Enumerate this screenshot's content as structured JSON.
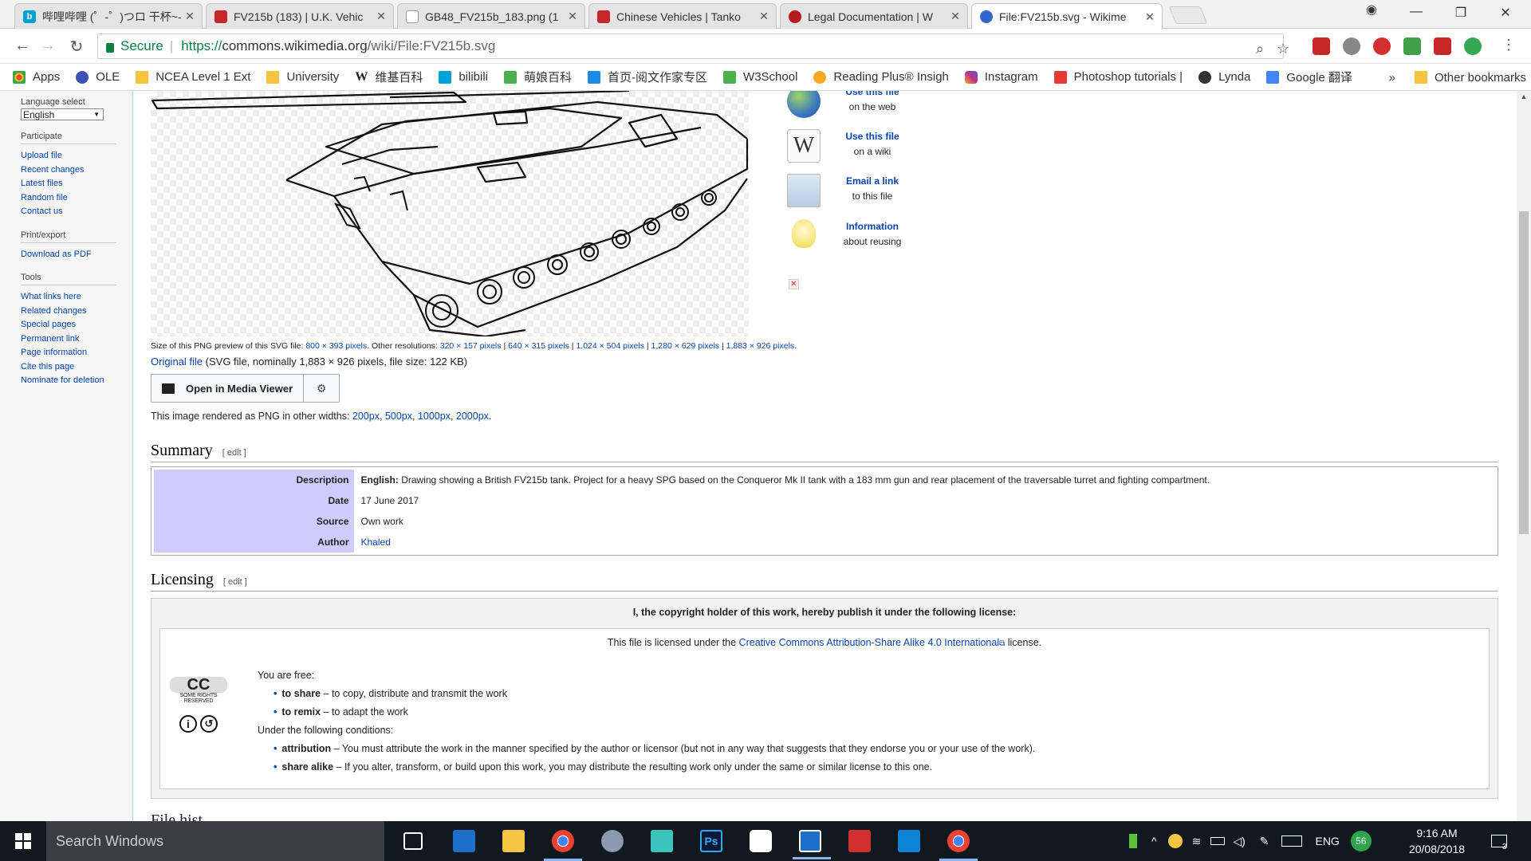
{
  "tabs": [
    {
      "title": "哔哩哔哩 (゜-゜)つロ 干杯~-",
      "color": "#00a1d6"
    },
    {
      "title": "FV215b (183) | U.K. Vehic",
      "color": "#c62828"
    },
    {
      "title": "GB48_FV215b_183.png (1",
      "color": "#777777"
    },
    {
      "title": "Chinese Vehicles | Tanko",
      "color": "#c62828"
    },
    {
      "title": "Legal Documentation | W",
      "color": "#b71c1c"
    },
    {
      "title": "File:FV215b.svg - Wikime",
      "color": "#3366cc"
    }
  ],
  "address": {
    "secure_label": "Secure",
    "scheme": "https://",
    "host": "commons.wikimedia.org",
    "path": "/wiki/File:FV215b.svg"
  },
  "bookmarks": [
    {
      "label": "Apps",
      "icon": "apps-grid-icon",
      "color": "#e94235"
    },
    {
      "label": "OLE",
      "icon": "ole-icon",
      "color": "#3f51b5"
    },
    {
      "label": "NCEA Level 1 Ext",
      "icon": "folder-icon",
      "color": "#f5c542"
    },
    {
      "label": "University",
      "icon": "folder-icon",
      "color": "#f5c542"
    },
    {
      "label": "维基百科",
      "icon": "wikipedia-icon",
      "color": "#222222"
    },
    {
      "label": "bilibili",
      "icon": "bilibili-icon",
      "color": "#00a1d6"
    },
    {
      "label": "萌娘百科",
      "icon": "moegirl-icon",
      "color": "#4caf50"
    },
    {
      "label": "首页-阅文作家专区",
      "icon": "yuewen-icon",
      "color": "#1e88e5"
    },
    {
      "label": "W3School",
      "icon": "w3school-icon",
      "color": "#4caf50"
    },
    {
      "label": "Reading Plus® Insigh",
      "icon": "reading-plus-icon",
      "color": "#f9a825"
    },
    {
      "label": "Instagram",
      "icon": "instagram-icon",
      "color": "#c13584"
    },
    {
      "label": "Photoshop tutorials |",
      "icon": "adobe-icon",
      "color": "#e53935"
    },
    {
      "label": "Lynda",
      "icon": "lynda-icon",
      "color": "#333333"
    },
    {
      "label": "Google 翻译",
      "icon": "google-translate-icon",
      "color": "#4285f4"
    }
  ],
  "bookmarks_more": "»",
  "bookmarks_other": "Other bookmarks",
  "sidebar": {
    "language_heading": "Language select",
    "language_value": "English",
    "sections": [
      {
        "heading": "Participate",
        "links": [
          "Upload file",
          "Recent changes",
          "Latest files",
          "Random file",
          "Contact us"
        ]
      },
      {
        "heading": "Print/export",
        "links": [
          "Download as PDF"
        ]
      },
      {
        "heading": "Tools",
        "links": [
          "What links here",
          "Related changes",
          "Special pages",
          "Permanent link",
          "Page information",
          "Cite this page",
          "Nominate for deletion"
        ]
      }
    ]
  },
  "file": {
    "size_prefix": "Size of this PNG preview of this SVG file:",
    "size_value": "800 × 393 pixels",
    "other_res_label": ". Other resolutions:",
    "resolutions": [
      "320 × 157 pixels",
      "640 × 315 pixels",
      "1,024 × 504 pixels",
      "1,280 × 629 pixels",
      "1,883 × 926 pixels"
    ],
    "original_link": "Original file",
    "original_info": "(SVG file, nominally 1,883 × 926 pixels, file size: 122 KB)",
    "open_mv": "Open in Media Viewer",
    "render_prefix": "This image rendered as PNG in other widths:",
    "widths": [
      "200px",
      "500px",
      "1000px",
      "2000px"
    ]
  },
  "use_file": [
    {
      "head": "Use this file",
      "sub": "on the web",
      "icon": "globe-icon"
    },
    {
      "head": "Use this file",
      "sub": "on a wiki",
      "icon": "wiki-w-icon"
    },
    {
      "head": "Email a link",
      "sub": "to this file",
      "icon": "email-icon"
    },
    {
      "head": "Information",
      "sub": "about reusing",
      "icon": "lightbulb-icon"
    }
  ],
  "summary": {
    "heading": "Summary",
    "edit": "[ edit ]",
    "rows": [
      {
        "key": "Description",
        "bold_prefix": "English:",
        "value": "Drawing showing a British FV215b tank. Project for a heavy SPG based on the Conqueror Mk II tank with a 183 mm gun and rear placement of the traversable turret and fighting compartment.",
        "link": false
      },
      {
        "key": "Date",
        "bold_prefix": "",
        "value": "17 June 2017",
        "link": false
      },
      {
        "key": "Source",
        "bold_prefix": "",
        "value": "Own work",
        "link": false
      },
      {
        "key": "Author",
        "bold_prefix": "",
        "value": "Khaled",
        "link": true
      }
    ]
  },
  "licensing": {
    "heading": "Licensing",
    "edit": "[ edit ]",
    "title": "I, the copyright holder of this work, hereby publish it under the following license:",
    "line_prefix": "This file is licensed under the",
    "license_link": "Creative Commons Attribution-Share Alike 4.0 International",
    "line_suffix": "license.",
    "cc_text": "SOME RIGHTS RESERVED",
    "free_label": "You are free:",
    "free_items": [
      {
        "term": "to share",
        "desc": "– to copy, distribute and transmit the work"
      },
      {
        "term": "to remix",
        "desc": "– to adapt the work"
      }
    ],
    "conditions_label": "Under the following conditions:",
    "conditions": [
      {
        "term": "attribution",
        "desc": "– You must attribute the work in the manner specified by the author or licensor (but not in any way that suggests that they endorse you or your use of the work)."
      },
      {
        "term": "share alike",
        "desc": "– If you alter, transform, or build upon this work, you may distribute the resulting work only under the same or similar license to this one."
      }
    ]
  },
  "next_heading_partial": "File hist",
  "taskbar": {
    "search_placeholder": "Search Windows",
    "lang": "ENG",
    "badge": "56",
    "time": "9:16 AM",
    "date": "20/08/2018",
    "notif_count": "3"
  }
}
